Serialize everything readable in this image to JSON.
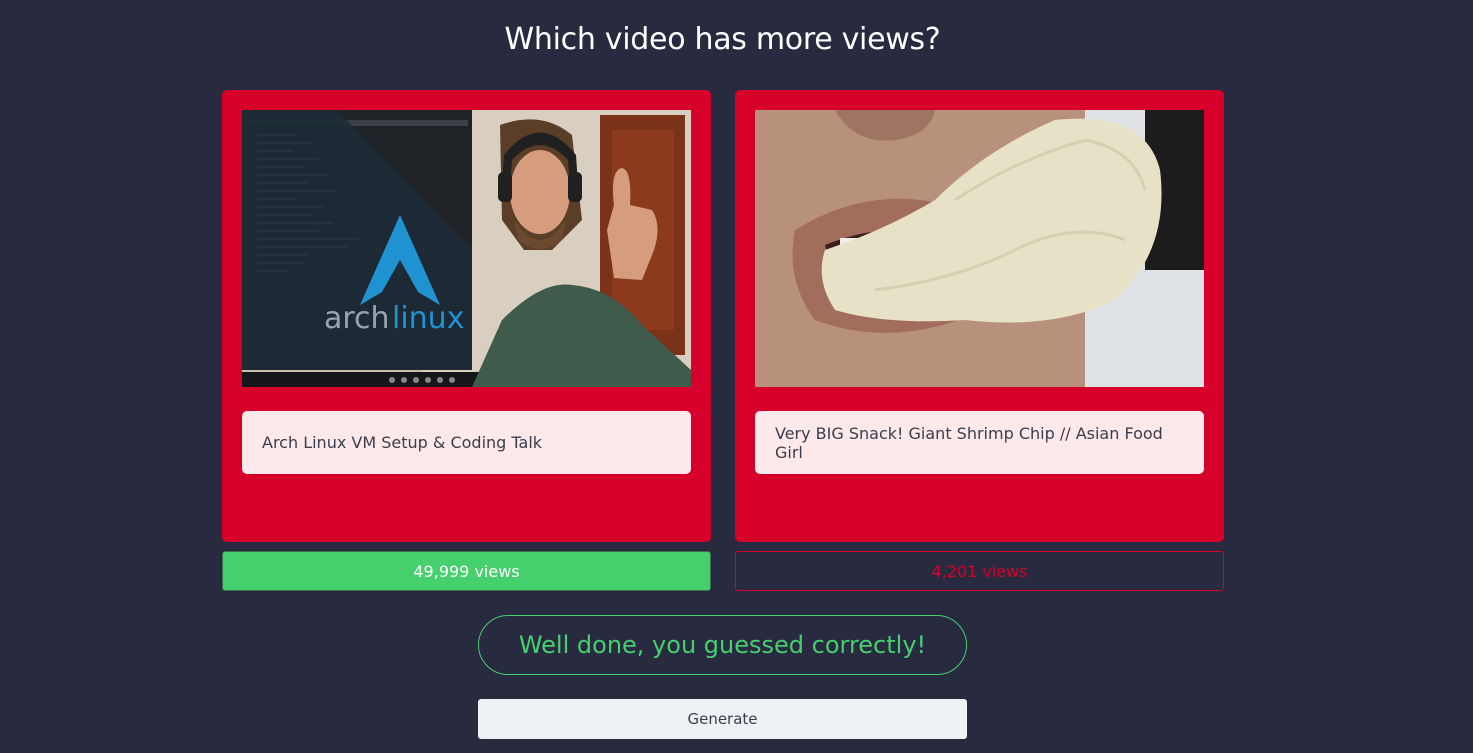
{
  "page": {
    "question": "Which video has more views?"
  },
  "videos": [
    {
      "title": "Arch Linux VM Setup & Coding Talk",
      "views": "49,999 views",
      "status": "correct",
      "thumbnail_logo_text_a": "arch",
      "thumbnail_logo_text_b": "linux",
      "thumbnail_icon": "arch-linux-logo-icon"
    },
    {
      "title": "Very BIG Snack! Giant Shrimp Chip // Asian Food Girl",
      "views": "4,201 views",
      "status": "wrong"
    }
  ],
  "result": {
    "message": "Well done, you guessed correctly!"
  },
  "controls": {
    "generate_label": "Generate"
  },
  "colors": {
    "background": "#282a40",
    "card": "#d6002a",
    "caption_bg": "#fde9ea",
    "correct": "#45cf6d",
    "wrong": "#d6002a",
    "button_bg": "#eef2f5"
  }
}
